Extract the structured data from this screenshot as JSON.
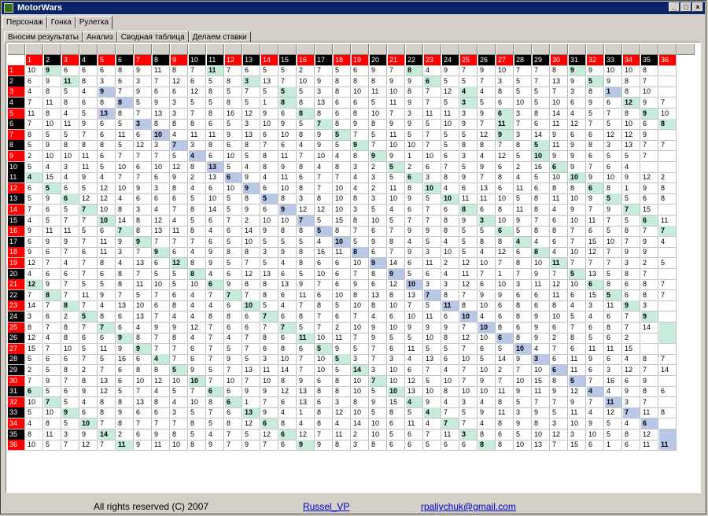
{
  "window": {
    "title": "MotorWars",
    "buttons": [
      "_",
      "□",
      "×"
    ]
  },
  "main_tabs": [
    {
      "label": "Персонаж",
      "active": false
    },
    {
      "label": "Гонка",
      "active": false
    },
    {
      "label": "Рулетка",
      "active": true
    }
  ],
  "sub_tabs": [
    {
      "label": "Вносим результаты",
      "active": false
    },
    {
      "label": "Анализ",
      "active": false
    },
    {
      "label": "Сводная таблица",
      "active": true
    },
    {
      "label": "Делаем ставки",
      "active": false
    }
  ],
  "table": {
    "red_numbers": [
      1,
      3,
      5,
      7,
      9,
      12,
      14,
      16,
      18,
      19,
      21,
      23,
      25,
      27,
      30,
      32,
      34,
      36
    ],
    "colors": {
      "red": "#ff0000",
      "black": "#000000",
      "green_highlight": "#c8ecdc",
      "blue_highlight": "#b8c8e6"
    },
    "rows": [
      "10 9 6 6 6 8 9 11 8 7 11 7 6 5 5 2 7 5 6 9 7 8 4 9 7 9 10 7 7 8 9 9 10 10 8",
      "6 9 11 8 3 6 3 7 12 6 5 8 3 13 7 10 9 8 8 8 9 9 6 5 5 7 3 5 7 13 9 5 9 8 7",
      "4 8 5 4 9 7 9 6 6 12 8 5 7 5 5 5 3 8 10 11 10 8 7 12 4 4 8 5 5 7 3 8 1 8 10",
      "7 11 8 6 8 8 5 9 3 5 5 8 5 1 8 8 13 6 6 5 11 9 7 5 3 5 6 10 5 10 6 9 6 12 9 7",
      "11 8 4 5 13 8 7 13 3 7 8 16 12 9 6 8 8 6 8 10 7 3 11 11 3 9 6 3 8 14 4 5 7 8 9 10",
      "7 10 11 9 6 5 3 8 8 8 6 5 3 10 9 5 7 8 9 8 9 9 5 10 9 7 11 7 6 11 12 7 5 10 6 8 5",
      "8 5 5 7 6 11 6 10 4 11 11 9 13 6 10 8 9 5 7 5 11 5 7 5 5 12 9 3 14 9 6 6 12 12 9",
      "5 9 8 8 8 5 12 3 7 3 8 6 8 7 6 4 9 5 9 7 10 10 7 5 8 8 7 8 5 11 9 8 3 13 7 7",
      "2 10 10 11 6 7 7 7 5 4 6 10 5 8 11 7 10 4 8 9 9 1 10 6 3 4 12 5 10 9 9 6 5 5 7",
      "5 4 3 11 5 10 6 10 12 8 13 5 4 8 9 8 4 8 3 2 5 2 6 7 5 9 6 2 16 6 9 7 6 4",
      "4 15 4 9 4 7 7 6 9 2 13 6 9 4 11 6 7 7 4 3 5 6 3 8 9 7 8 4 5 10 10 9 10 9 12 2",
      "6 5 6 5 12 10 9 3 8 4 6 10 9 6 10 8 7 10 4 2 11 8 10 4 6 13 6 11 6 8 8 6 8 1 9 8",
      "5 9 6 12 12 4 6 6 6 5 10 5 8 5 8 3 8 10 8 3 10 9 5 10 11 11 10 5 8 11 10 9 5 5 6 8",
      "7 6 5 7 10 8 3 4 7 8 14 5 9 6 9 12 12 10 3 5 4 6 7 6 8 6 8 11 8 4 9 7 9 7 15",
      "4 5 7 7 10 14 8 12 4 5 6 7 2 10 10 7 5 15 8 10 5 7 7 8 9 3 10 9 7 6 10 11 7 5 6 11",
      "9 11 11 5 6 7 8 13 11 8 4 6 14 9 8 8 5 8 7 6 7 9 9 8 5 5 6 5 8 8 7 6 5 8 7 7",
      "6 9 9 7 11 9 9 7 7 7 6 5 10 5 5 5 4 10 5 9 8 4 5 4 5 8 8 4 4 6 7 15 10 7 9 4",
      "9 6 7 6 11 3 7 9 6 4 9 8 8 3 9 8 16 11 8 6 7 9 3 10 5 4 12 6 8 4 10 12 7 9 9",
      "12 7 4 7 8 4 13 6 12 8 9 5 7 5 4 8 6 6 10 9 14 6 11 2 12 10 7 8 10 11 7 7 7 3 2 5",
      "4 6 6 7 6 8 7 5 5 8 4 6 12 13 6 5 10 6 7 8 9 5 6 4 11 7 1 7 9 7 5 13 5 8 7",
      "12 9 7 5 5 8 11 10 5 10 6 9 8 8 13 9 7 6 9 6 12 10 3 3 12 6 10 3 11 12 10 6 8 6 8 7",
      "7 8 7 11 9 7 5 7 6 4 7 7 7 8 6 11 6 10 8 13 8 13 7 8 7 9 9 6 6 11 6 15 5 6 8 7",
      "14 7 8 7 4 13 10 6 8 4 4 6 10 5 4 7 8 5 10 8 10 7 5 11 8 10 6 8 6 8 4 3 11 9 3",
      "3 6 2 5 8 6 13 7 4 4 8 8 6 7 6 8 7 6 7 4 6 10 11 6 10 4 6 8 9 10 5 4 6 7 9",
      "8 7 8 7 7 6 4 9 9 12 7 6 6 7 7 5 7 2 10 9 10 9 9 9 7 10 8 6 9 6 7 6 8 7 14",
      "12 4 8 6 6 9 8 7 8 4 7 4 7 8 6 11 10 11 7 9 5 5 10 8 12 10 6 8 9 2 8 5 6 2",
      "15 7 10 5 11 9 9 7 7 6 7 5 7 6 8 6 5 9 5 7 6 11 5 5 7 6 5 10 4 7 6 11 11 15",
      "5 6 6 7 5 16 6 4 7 6 7 9 5 3 10 7 10 5 3 7 3 4 13 6 10 5 14 9 3 6 11 9 6 4 8 7",
      "2 5 8 2 7 6 8 8 5 9 5 7 13 11 14 7 10 5 14 3 10 6 7 4 7 10 2 7 10 6 11 6 3 12 7 14",
      "7 9 7 8 13 6 10 12 10 10 7 10 7 10 8 9 6 8 10 7 10 12 5 10 7 9 7 10 15 8 5 7 16 6 9",
      "6 5 6 9 12 5 7 4 5 7 6 6 9 9 12 13 8 8 10 5 10 13 10 8 10 10 11 9 11 9 12 4 4 9 8 6",
      "10 7 5 4 8 8 13 8 4 10 8 6 1 7 6 13 6 3 8 9 15 4 9 4 3 4 8 5 7 7 9 7 11 3 7",
      "5 10 9 6 8 9 6 6 3 5 7 6 13 9 4 1 8 12 10 5 8 5 4 7 5 9 11 3 9 5 11 4 12 7 11 8",
      "4 8 5 10 7 8 7 7 7 8 5 8 12 6 8 4 8 4 14 10 6 11 4 7 7 4 8 9 8 3 10 9 5 4 6",
      "8 11 3 9 14 2 6 9 8 5 4 7 5 12 6 12 7 11 2 10 5 6 7 11 3 8 6 5 10 12 3 10 5 8 12",
      "10 5 7 12 7 11 9 11 10 8 9 7 9 7 6 9 9 8 3 8 6 6 5 6 6 8 8 10 13 7 15 6 1 6 11 11"
    ],
    "highlights": [
      [
        1,
        2,
        1
      ],
      [
        1,
        11,
        1
      ],
      [
        1,
        22,
        1
      ],
      [
        1,
        31,
        1
      ],
      [
        2,
        3,
        1
      ],
      [
        2,
        13,
        1
      ],
      [
        2,
        23,
        1
      ],
      [
        2,
        32,
        1
      ],
      [
        3,
        5,
        2
      ],
      [
        3,
        15,
        1
      ],
      [
        3,
        25,
        1
      ],
      [
        3,
        33,
        2
      ],
      [
        4,
        6,
        2
      ],
      [
        4,
        15,
        1
      ],
      [
        4,
        25,
        1
      ],
      [
        4,
        34,
        1
      ],
      [
        5,
        5,
        2
      ],
      [
        5,
        16,
        1
      ],
      [
        5,
        27,
        1
      ],
      [
        5,
        35,
        1
      ],
      [
        6,
        7,
        2
      ],
      [
        6,
        17,
        1
      ],
      [
        6,
        27,
        1
      ],
      [
        6,
        36,
        1
      ],
      [
        7,
        8,
        2
      ],
      [
        7,
        18,
        1
      ],
      [
        7,
        27,
        1
      ],
      [
        8,
        9,
        2
      ],
      [
        8,
        19,
        1
      ],
      [
        8,
        29,
        1
      ],
      [
        9,
        10,
        2
      ],
      [
        9,
        20,
        1
      ],
      [
        9,
        29,
        1
      ],
      [
        10,
        11,
        2
      ],
      [
        10,
        21,
        1
      ],
      [
        10,
        30,
        1
      ],
      [
        11,
        1,
        1
      ],
      [
        11,
        12,
        2
      ],
      [
        11,
        22,
        1
      ],
      [
        11,
        31,
        1
      ],
      [
        12,
        2,
        1
      ],
      [
        12,
        13,
        2
      ],
      [
        12,
        23,
        1
      ],
      [
        12,
        32,
        1
      ],
      [
        13,
        3,
        1
      ],
      [
        13,
        14,
        2
      ],
      [
        13,
        24,
        1
      ],
      [
        13,
        33,
        1
      ],
      [
        14,
        4,
        1
      ],
      [
        14,
        15,
        2
      ],
      [
        14,
        25,
        1
      ],
      [
        14,
        34,
        1
      ],
      [
        15,
        5,
        1
      ],
      [
        15,
        16,
        2
      ],
      [
        15,
        26,
        1
      ],
      [
        15,
        35,
        1
      ],
      [
        16,
        6,
        1
      ],
      [
        16,
        17,
        2
      ],
      [
        16,
        27,
        1
      ],
      [
        16,
        36,
        1
      ],
      [
        17,
        7,
        1
      ],
      [
        17,
        18,
        2
      ],
      [
        17,
        28,
        1
      ],
      [
        18,
        8,
        1
      ],
      [
        18,
        19,
        2
      ],
      [
        18,
        29,
        1
      ],
      [
        19,
        9,
        1
      ],
      [
        19,
        20,
        2
      ],
      [
        19,
        30,
        1
      ],
      [
        20,
        10,
        1
      ],
      [
        20,
        21,
        2
      ],
      [
        20,
        31,
        1
      ],
      [
        21,
        1,
        1
      ],
      [
        21,
        11,
        1
      ],
      [
        21,
        22,
        2
      ],
      [
        21,
        32,
        1
      ],
      [
        22,
        2,
        1
      ],
      [
        22,
        12,
        1
      ],
      [
        22,
        23,
        2
      ],
      [
        22,
        33,
        1
      ],
      [
        23,
        3,
        1
      ],
      [
        23,
        13,
        1
      ],
      [
        23,
        24,
        2
      ],
      [
        23,
        34,
        1
      ],
      [
        24,
        4,
        1
      ],
      [
        24,
        14,
        1
      ],
      [
        24,
        25,
        2
      ],
      [
        24,
        35,
        1
      ],
      [
        25,
        5,
        1
      ],
      [
        25,
        15,
        1
      ],
      [
        25,
        26,
        2
      ],
      [
        25,
        36,
        1
      ],
      [
        26,
        6,
        1
      ],
      [
        26,
        16,
        1
      ],
      [
        26,
        27,
        2
      ],
      [
        26,
        36,
        1
      ],
      [
        27,
        7,
        1
      ],
      [
        27,
        17,
        1
      ],
      [
        27,
        28,
        2
      ],
      [
        28,
        8,
        1
      ],
      [
        28,
        18,
        1
      ],
      [
        28,
        29,
        2
      ],
      [
        29,
        9,
        1
      ],
      [
        29,
        19,
        1
      ],
      [
        29,
        30,
        2
      ],
      [
        30,
        10,
        1
      ],
      [
        30,
        20,
        1
      ],
      [
        30,
        31,
        2
      ],
      [
        31,
        1,
        1
      ],
      [
        31,
        11,
        1
      ],
      [
        31,
        21,
        1
      ],
      [
        31,
        32,
        2
      ],
      [
        32,
        2,
        1
      ],
      [
        32,
        12,
        1
      ],
      [
        32,
        22,
        1
      ],
      [
        32,
        33,
        2
      ],
      [
        33,
        3,
        1
      ],
      [
        33,
        13,
        1
      ],
      [
        33,
        23,
        1
      ],
      [
        33,
        34,
        2
      ],
      [
        34,
        4,
        1
      ],
      [
        34,
        14,
        1
      ],
      [
        34,
        24,
        1
      ],
      [
        34,
        35,
        2
      ],
      [
        35,
        5,
        1
      ],
      [
        35,
        15,
        1
      ],
      [
        35,
        25,
        1
      ],
      [
        35,
        36,
        2
      ],
      [
        36,
        6,
        1
      ],
      [
        36,
        16,
        1
      ],
      [
        36,
        26,
        1
      ],
      [
        36,
        36,
        2
      ]
    ]
  },
  "footer": {
    "copyright": "All rights reserved (C) 2007",
    "author": "Russel_VP",
    "email": "rpaliychuk@gmail.com"
  }
}
